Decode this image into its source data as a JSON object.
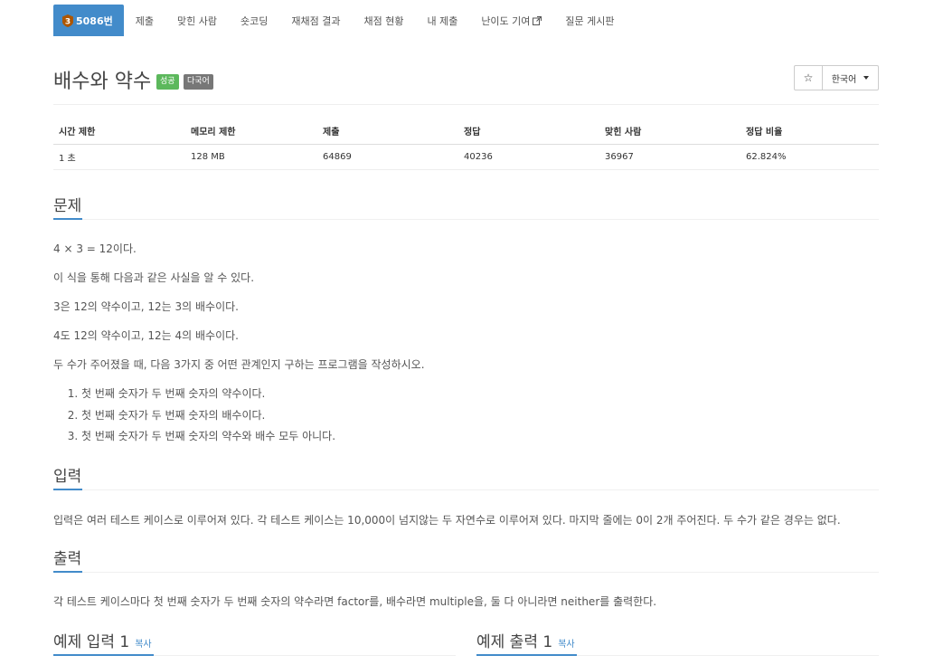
{
  "tabs": [
    {
      "label": "5086번",
      "medal_level": "3"
    },
    {
      "label": "제출"
    },
    {
      "label": "맞힌 사람"
    },
    {
      "label": "숏코딩"
    },
    {
      "label": "재채점 결과"
    },
    {
      "label": "채점 현황"
    },
    {
      "label": "내 제출"
    },
    {
      "label": "난이도 기여"
    },
    {
      "label": "질문 게시판"
    }
  ],
  "problem": {
    "title": "배수와 약수",
    "badges": {
      "success": "성공",
      "multi": "다국어"
    },
    "language": "한국어",
    "star": "☆"
  },
  "info": {
    "headers": [
      "시간 제한",
      "메모리 제한",
      "제출",
      "정답",
      "맞힌 사람",
      "정답 비율"
    ],
    "values": [
      "1 초",
      "128 MB",
      "64869",
      "40236",
      "36967",
      "62.824%"
    ]
  },
  "sections": {
    "problem": "문제",
    "input": "입력",
    "output": "출력",
    "sample_input": "예제 입력 1",
    "sample_output": "예제 출력 1",
    "copy": "복사"
  },
  "problem_text": [
    "4 × 3 = 12이다.",
    "이 식을 통해 다음과 같은 사실을 알 수 있다.",
    "3은 12의 약수이고, 12는 3의 배수이다.",
    "4도 12의 약수이고, 12는 4의 배수이다.",
    "두 수가 주어졌을 때, 다음 3가지 중 어떤 관계인지 구하는 프로그램을 작성하시오."
  ],
  "problem_list": [
    "첫 번째 숫자가 두 번째 숫자의 약수이다.",
    "첫 번째 숫자가 두 번째 숫자의 배수이다.",
    "첫 번째 숫자가 두 번째 숫자의 약수와 배수 모두 아니다."
  ],
  "input_text": "입력은 여러 테스트 케이스로 이루어져 있다. 각 테스트 케이스는 10,000이 넘지않는 두 자연수로 이루어져 있다. 마지막 줄에는 0이 2개 주어진다. 두 수가 같은 경우는 없다.",
  "output_text": "각 테스트 케이스마다 첫 번째 숫자가 두 번째 숫자의 약수라면 factor를, 배수라면 multiple을, 둘 다 아니라면 neither를 출력한다.",
  "colors": {
    "accent": "#428bca",
    "success": "#5cb85c",
    "muted": "#777777",
    "medal": "#ad5600"
  }
}
